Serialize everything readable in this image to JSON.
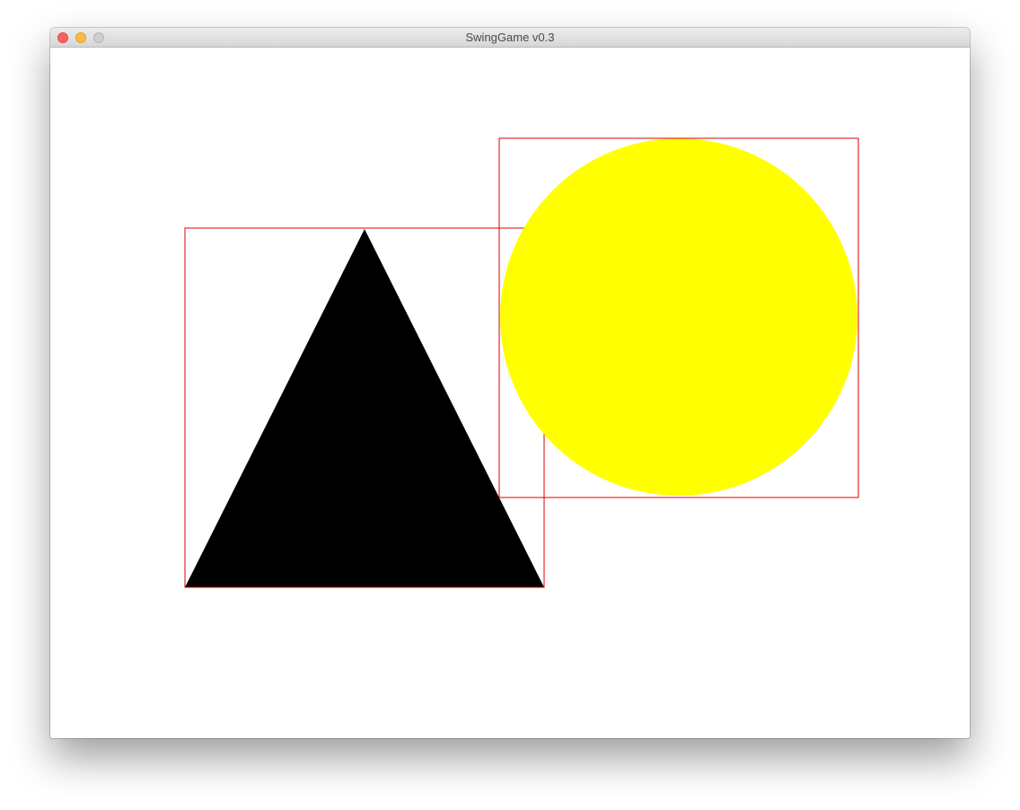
{
  "window": {
    "title": "SwingGame v0.3"
  },
  "colors": {
    "triangle_fill": "#000000",
    "circle_fill": "#ffff00",
    "bounding_box_stroke": "#dd0000",
    "canvas_background": "#ffffff"
  },
  "icons": {
    "close": "close-icon",
    "minimize": "minimize-icon",
    "zoom": "zoom-icon"
  }
}
